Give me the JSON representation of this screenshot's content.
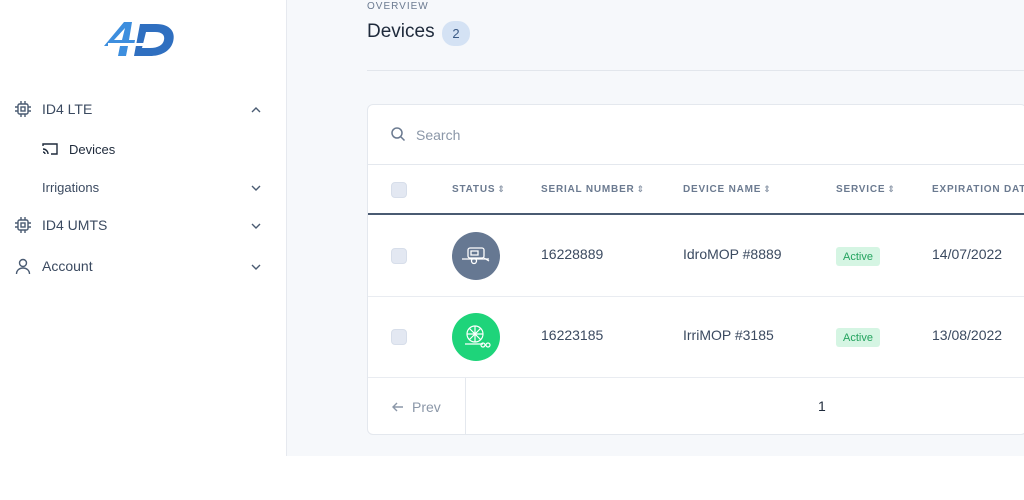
{
  "sidebar": {
    "logo_text": "4D",
    "items": [
      {
        "label": "ID4 LTE",
        "icon": "chip-icon",
        "expanded": true
      },
      {
        "label": "ID4 UMTS",
        "icon": "chip-icon",
        "expanded": false
      },
      {
        "label": "Account",
        "icon": "user-icon",
        "expanded": false
      }
    ],
    "sub_items": [
      {
        "label": "Devices",
        "icon": "cast-icon",
        "active": true
      },
      {
        "label": "Irrigations",
        "expandable": true
      }
    ]
  },
  "header": {
    "overline": "OVERVIEW",
    "title": "Devices",
    "count": "2"
  },
  "search": {
    "placeholder": "Search"
  },
  "table": {
    "columns": [
      "STATUS",
      "SERIAL NUMBER",
      "DEVICE NAME",
      "SERVICE",
      "EXPIRATION DAT"
    ],
    "rows": [
      {
        "status_icon": "trailer-icon",
        "status_color": "#667892",
        "serial": "16228889",
        "name": "IdroMOP #8889",
        "service": "Active",
        "expiration": "14/07/2022"
      },
      {
        "status_icon": "irrigation-reel-icon",
        "status_color": "#1ed47a",
        "serial": "16223185",
        "name": "IrriMOP #3185",
        "service": "Active",
        "expiration": "13/08/2022"
      }
    ]
  },
  "pagination": {
    "prev_label": "Prev",
    "current_page": "1"
  },
  "colors": {
    "accent": "#4a8ad4",
    "active_badge_bg": "#d5f5e3",
    "active_badge_text": "#23a35e"
  }
}
